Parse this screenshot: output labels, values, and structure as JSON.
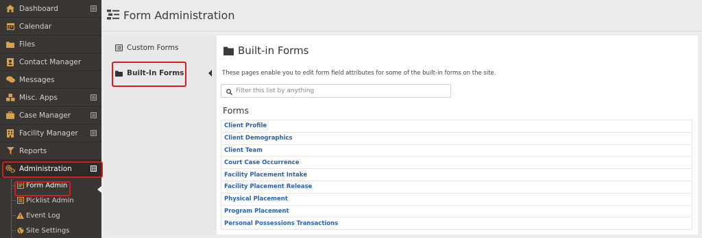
{
  "colors": {
    "sidebar_bg": "#3a3633",
    "accent": "#d8a14a",
    "link": "#2a62a9",
    "highlight": "#d21d1d"
  },
  "sidebar": {
    "items": [
      {
        "label": "Dashboard",
        "icon": "home-icon",
        "expandable": true
      },
      {
        "label": "Calendar",
        "icon": "calendar-icon",
        "expandable": false
      },
      {
        "label": "Files",
        "icon": "folder-icon",
        "expandable": false
      },
      {
        "label": "Contact Manager",
        "icon": "address-book-icon",
        "expandable": false
      },
      {
        "label": "Messages",
        "icon": "comments-icon",
        "expandable": false
      },
      {
        "label": "Misc. Apps",
        "icon": "cubes-icon",
        "expandable": true
      },
      {
        "label": "Case Manager",
        "icon": "briefcase-icon",
        "expandable": true
      },
      {
        "label": "Facility Manager",
        "icon": "building-icon",
        "expandable": true
      },
      {
        "label": "Reports",
        "icon": "filter-icon",
        "expandable": false
      },
      {
        "label": "Administration",
        "icon": "gears-icon",
        "expandable": true,
        "expanded": true
      }
    ],
    "expand_symbol": "⊞",
    "collapse_symbol": "⊟",
    "sub_items": [
      {
        "label": "Form Admin",
        "icon": "form-icon"
      },
      {
        "label": "Picklist Admin",
        "icon": "list-icon"
      },
      {
        "label": "Event Log",
        "icon": "warning-icon"
      },
      {
        "label": "Site Settings",
        "icon": "globe-icon"
      }
    ]
  },
  "header": {
    "title": "Form Administration",
    "icon": "form-admin-icon"
  },
  "tabs": [
    {
      "label": "Custom Forms",
      "icon": "list-alt-icon"
    },
    {
      "label": "Built-In Forms",
      "icon": "folder-icon",
      "selected": true
    }
  ],
  "main": {
    "title": "Built-in Forms",
    "description": "These pages enable you to edit form field attributes for some of the built-in forms on the site.",
    "filter_placeholder": "Filter this list by anything",
    "forms_heading": "Forms",
    "forms": [
      "Client Profile",
      "Client Demographics",
      "Client Team",
      "Court Case Occurrence",
      "Facility Placement Intake",
      "Facility Placement Release",
      "Physical Placement",
      "Program Placement",
      "Personal Possessions Transactions"
    ]
  }
}
